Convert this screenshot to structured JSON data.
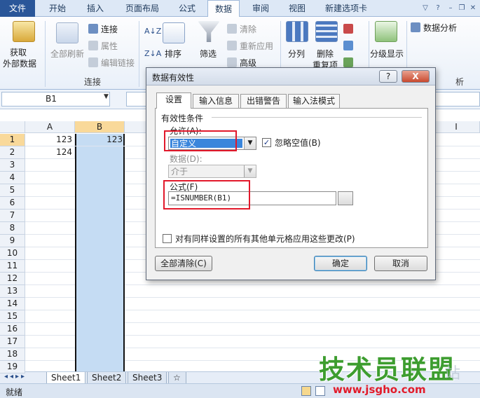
{
  "ribbon": {
    "tabs": [
      "文件",
      "开始",
      "插入",
      "页面布局",
      "公式",
      "数据",
      "审阅",
      "视图",
      "新建选项卡"
    ],
    "active_tab": "数据",
    "get_external": [
      "获取",
      "外部数据"
    ],
    "refresh_all": "全部刷新",
    "connections": "连接",
    "properties": "属性",
    "edit_links": "编辑链接",
    "group_connections": "连接",
    "sort": "排序",
    "filter": "筛选",
    "clear": "清除",
    "reapply": "重新应用",
    "advanced": "高级",
    "text_to_columns": "分列",
    "remove_duplicates": [
      "删除",
      "重复项"
    ],
    "outline": "分级显示",
    "data_analysis": "数据分析",
    "group_analysis": "析"
  },
  "formula_bar": {
    "name_box": "B1"
  },
  "grid": {
    "columns": [
      "A",
      "B",
      "I"
    ],
    "rows": [
      "1",
      "2",
      "3",
      "4",
      "5",
      "6",
      "7",
      "8",
      "9",
      "10",
      "11",
      "12",
      "13",
      "14",
      "15",
      "16",
      "17",
      "18",
      "19"
    ],
    "cells": {
      "A1": "123",
      "A2": "124",
      "B1": "123"
    }
  },
  "sheets": [
    "Sheet1",
    "Sheet2",
    "Sheet3"
  ],
  "status": "就绪",
  "dialog": {
    "title": "数据有效性",
    "help": "?",
    "close": "X",
    "tabs": [
      "设置",
      "输入信息",
      "出错警告",
      "输入法模式"
    ],
    "section_title": "有效性条件",
    "allow_label": "允许(A):",
    "allow_value": "自定义",
    "ignore_blank": "忽略空值(B)",
    "data_label": "数据(D):",
    "data_value": "介于",
    "formula_label": "公式(F)",
    "formula_value": "=ISNUMBER(B1)",
    "apply_all": "对有同样设置的所有其他单元格应用这些更改(P)",
    "clear_all": "全部清除(C)",
    "ok": "确定",
    "cancel": "取消"
  },
  "watermark": {
    "logo": "技术员联盟",
    "url": "www.jsgho.com",
    "faded": "站"
  },
  "colors": {
    "selection": "#c5dcf3",
    "accent": "#2a5699",
    "highlight": "#e2192b"
  }
}
